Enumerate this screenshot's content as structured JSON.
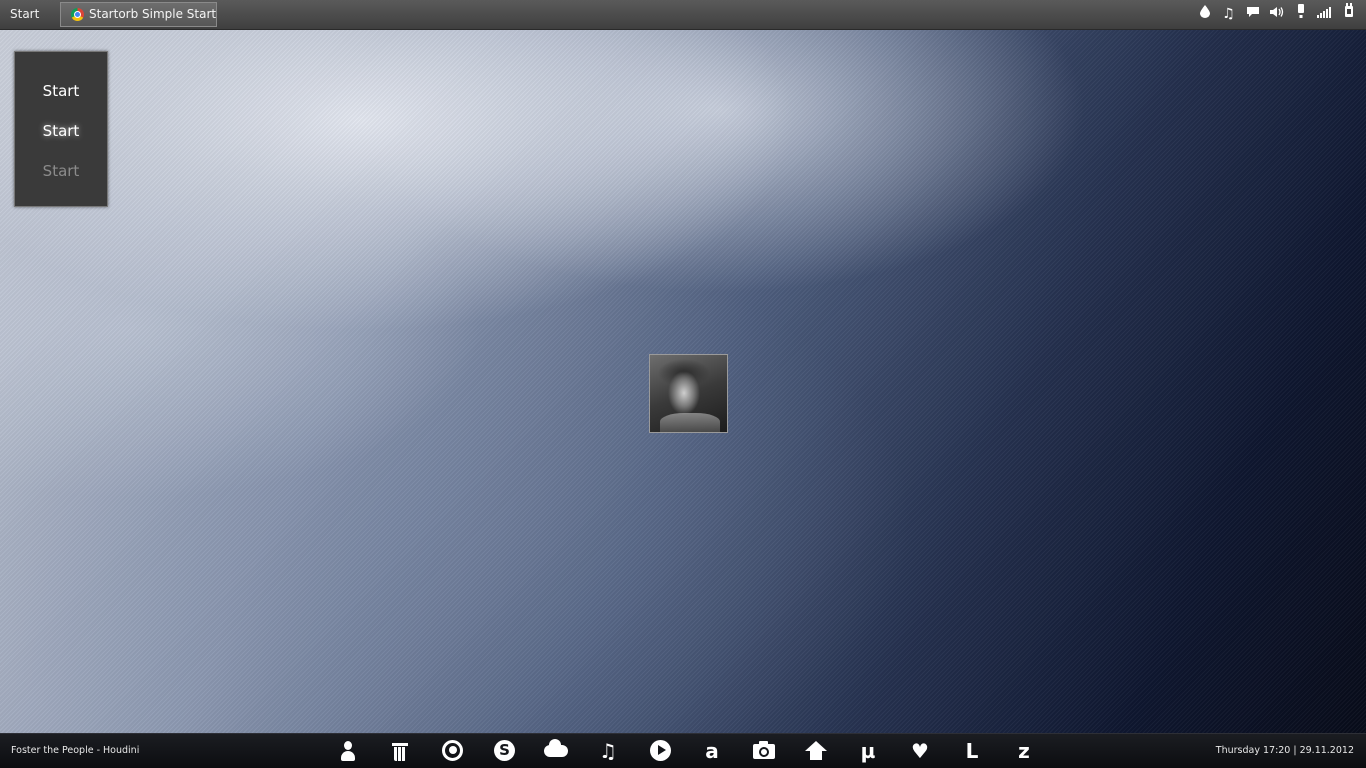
{
  "topbar": {
    "start_label": "Start",
    "active_task": {
      "label": "Startorb Simple Start ...",
      "icon": "chrome-icon"
    },
    "tray_icons": [
      "water-drop-icon",
      "music-note-icon",
      "chat-bubble-icon",
      "volume-icon",
      "battery-icon",
      "signal-icon",
      "power-plug-icon"
    ]
  },
  "start_menu": {
    "items": [
      {
        "label": "Start",
        "state": "normal"
      },
      {
        "label": "Start",
        "state": "hover"
      },
      {
        "label": "Start",
        "state": "pressed"
      }
    ]
  },
  "desktop": {
    "avatar": "user-photo"
  },
  "dock": {
    "now_playing": "Foster the People - Houdini",
    "clock": "Thursday 17:20 | 29.11.2012",
    "icons": [
      {
        "name": "user-icon",
        "glyph": ""
      },
      {
        "name": "trash-icon",
        "glyph": ""
      },
      {
        "name": "firefox-icon",
        "glyph": ""
      },
      {
        "name": "skype-icon",
        "glyph": "S"
      },
      {
        "name": "cloud-icon",
        "glyph": ""
      },
      {
        "name": "music-icon",
        "glyph": "♫"
      },
      {
        "name": "play-icon",
        "glyph": ""
      },
      {
        "name": "amazon-icon",
        "glyph": "a"
      },
      {
        "name": "camera-icon",
        "glyph": ""
      },
      {
        "name": "home-icon",
        "glyph": ""
      },
      {
        "name": "utorrent-icon",
        "glyph": "µ"
      },
      {
        "name": "heart-icon",
        "glyph": "♥"
      },
      {
        "name": "lastfm-icon",
        "glyph": "L"
      },
      {
        "name": "z-icon",
        "glyph": "z"
      }
    ]
  },
  "colors": {
    "topbar": "#4a4a4a",
    "dock": "#14161a",
    "start_box": "#3a3a3a"
  }
}
